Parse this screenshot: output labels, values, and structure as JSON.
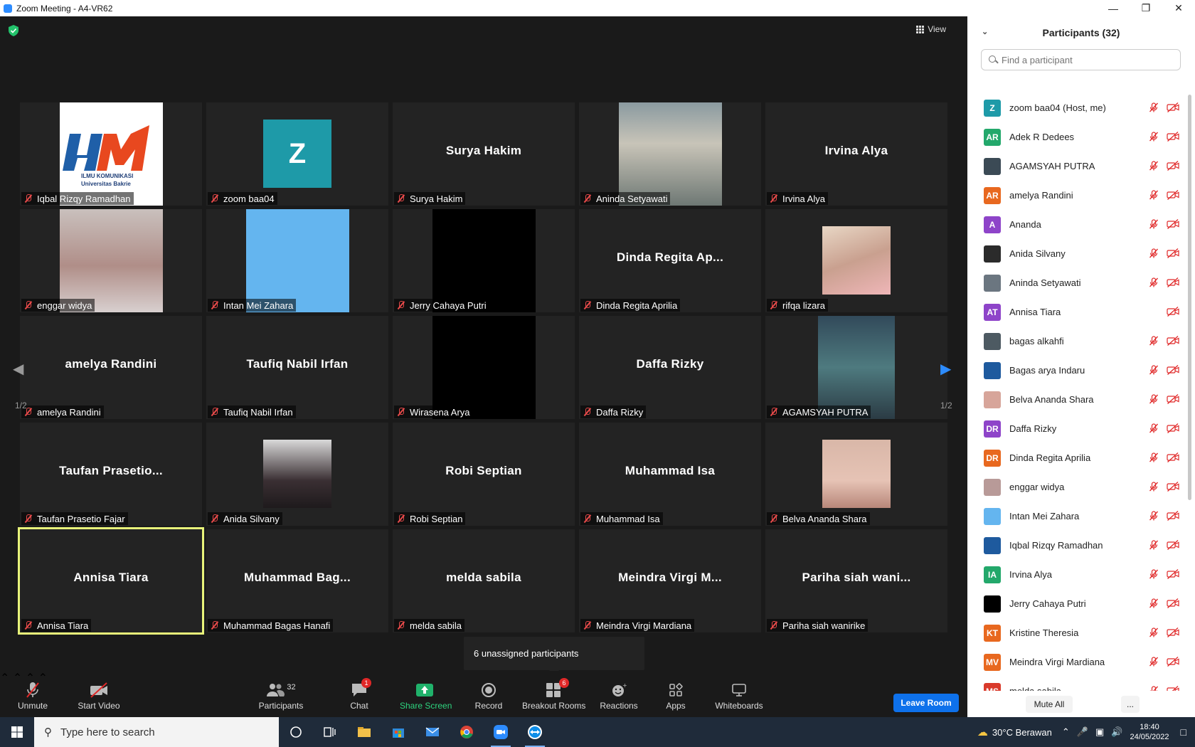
{
  "window": {
    "title": "Zoom Meeting - A4-VR62"
  },
  "stage": {
    "view_label": "View",
    "page_left": "1/2",
    "page_right": "1/2",
    "tiles": [
      {
        "big": "",
        "label": "Iqbal Rizqy Ramadhan"
      },
      {
        "big": "",
        "label": "zoom baa04",
        "letter": "Z"
      },
      {
        "big": "Surya Hakim",
        "label": "Surya Hakim"
      },
      {
        "big": "",
        "label": "Aninda Setyawati"
      },
      {
        "big": "Irvina Alya",
        "label": "Irvina Alya"
      },
      {
        "big": "",
        "label": "enggar widya"
      },
      {
        "big": "",
        "label": "Intan Mei Zahara"
      },
      {
        "big": "",
        "label": "Jerry Cahaya Putri"
      },
      {
        "big": "Dinda Regita Ap...",
        "label": "Dinda Regita Aprilia"
      },
      {
        "big": "",
        "label": "rifqa lizara"
      },
      {
        "big": "amelya Randini",
        "label": "amelya Randini"
      },
      {
        "big": "Taufiq Nabil Irfan",
        "label": "Taufiq Nabil Irfan"
      },
      {
        "big": "",
        "label": "Wirasena Arya"
      },
      {
        "big": "Daffa Rizky",
        "label": "Daffa Rizky"
      },
      {
        "big": "",
        "label": "AGAMSYAH PUTRA"
      },
      {
        "big": "Taufan Prasetio...",
        "label": "Taufan Prasetio Fajar"
      },
      {
        "big": "",
        "label": "Anida Silvany"
      },
      {
        "big": "Robi Septian",
        "label": "Robi Septian"
      },
      {
        "big": "Muhammad Isa",
        "label": "Muhammad Isa"
      },
      {
        "big": "",
        "label": "Belva Ananda Shara"
      },
      {
        "big": "Annisa Tiara",
        "label": "Annisa Tiara"
      },
      {
        "big": "Muhammad Bag...",
        "label": "Muhammad Bagas Hanafi"
      },
      {
        "big": "melda sabila",
        "label": "melda sabila"
      },
      {
        "big": "Meindra Virgi M...",
        "label": "Meindra Virgi Mardiana"
      },
      {
        "big": "Pariha siah wani...",
        "label": "Pariha siah wanirike"
      }
    ],
    "logo_text_1": "ILMU KOMUNIKASI",
    "logo_text_2": "Universitas Bakrie",
    "tooltip": "6 unassigned participants"
  },
  "toolbar": {
    "unmute": "Unmute",
    "start_video": "Start Video",
    "participants": "Participants",
    "participants_count": "32",
    "chat": "Chat",
    "chat_badge": "1",
    "share_screen": "Share Screen",
    "record": "Record",
    "breakout": "Breakout Rooms",
    "breakout_badge": "6",
    "reactions": "Reactions",
    "apps": "Apps",
    "whiteboards": "Whiteboards",
    "leave": "Leave Room",
    "colors": {
      "share": "#20b26b",
      "leave": "#0e71eb",
      "badge": "#e02828",
      "muted": "#e84a4a"
    }
  },
  "panel": {
    "title": "Participants (32)",
    "search_placeholder": "Find a participant",
    "mute_all": "Mute All",
    "more": "...",
    "participants": [
      {
        "initials": "Z",
        "color": "#1e9aa8",
        "name": "zoom baa04 (Host, me)"
      },
      {
        "initials": "AR",
        "color": "#23a86b",
        "name": "Adek R Dedees"
      },
      {
        "initials": "",
        "color": "#3b4a55",
        "name": "AGAMSYAH PUTRA"
      },
      {
        "initials": "AR",
        "color": "#e8681f",
        "name": "amelya Randini"
      },
      {
        "initials": "A",
        "color": "#8e44c9",
        "name": "Ananda"
      },
      {
        "initials": "",
        "color": "#2b2b2b",
        "name": "Anida Silvany"
      },
      {
        "initials": "",
        "color": "#6b7680",
        "name": "Aninda Setyawati"
      },
      {
        "initials": "AT",
        "color": "#8e44c9",
        "name": "Annisa Tiara",
        "no_mic": true
      },
      {
        "initials": "",
        "color": "#4d5a62",
        "name": "bagas alkahfi"
      },
      {
        "initials": "",
        "color": "#1e5a9e",
        "name": "Bagas arya Indaru"
      },
      {
        "initials": "",
        "color": "#d7a59a",
        "name": "Belva Ananda Shara"
      },
      {
        "initials": "DR",
        "color": "#8e44c9",
        "name": "Daffa Rizky"
      },
      {
        "initials": "DR",
        "color": "#e8681f",
        "name": "Dinda Regita Aprilia"
      },
      {
        "initials": "",
        "color": "#b89a98",
        "name": "enggar widya"
      },
      {
        "initials": "",
        "color": "#64b5ef",
        "name": "Intan Mei Zahara"
      },
      {
        "initials": "",
        "color": "#1e5a9e",
        "name": "Iqbal Rizqy Ramadhan"
      },
      {
        "initials": "IA",
        "color": "#23a86b",
        "name": "Irvina Alya"
      },
      {
        "initials": "",
        "color": "#000000",
        "name": "Jerry Cahaya Putri"
      },
      {
        "initials": "KT",
        "color": "#e8681f",
        "name": "Kristine Theresia"
      },
      {
        "initials": "MV",
        "color": "#e8681f",
        "name": "Meindra Virgi Mardiana"
      },
      {
        "initials": "MS",
        "color": "#d93a2b",
        "name": "melda sabila"
      }
    ]
  },
  "taskbar": {
    "search_placeholder": "Type here to search",
    "weather": "30°C  Berawan",
    "time": "18:40",
    "date": "24/05/2022"
  }
}
